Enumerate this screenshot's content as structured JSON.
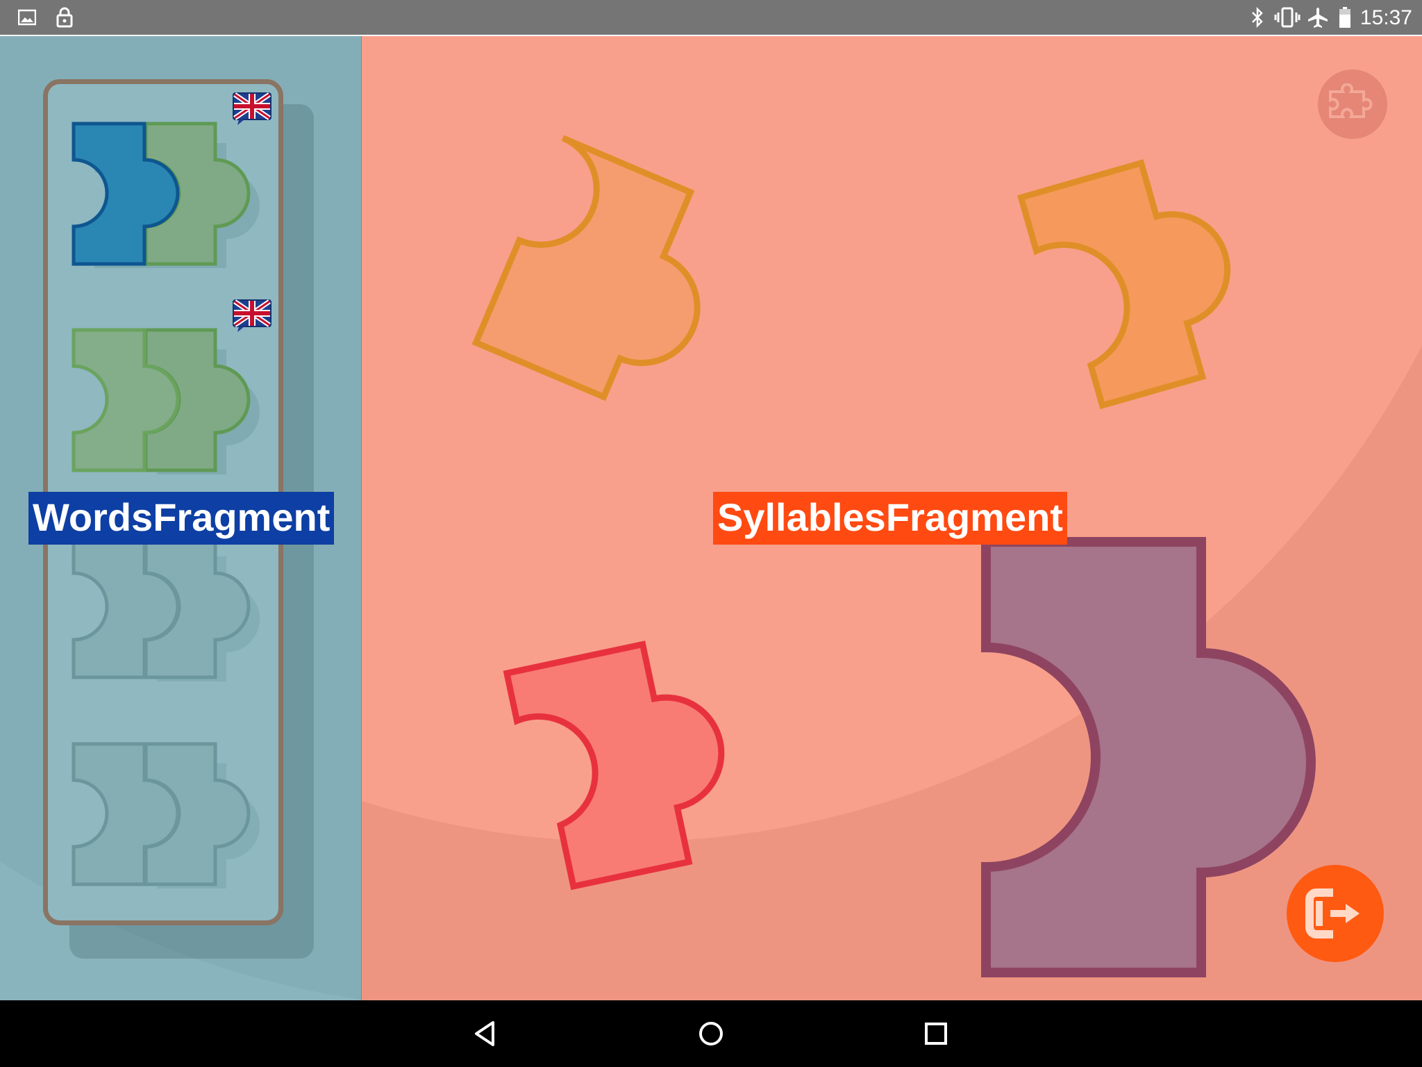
{
  "status_bar": {
    "time": "15:37",
    "left_icons": [
      "image-icon",
      "lock-icon"
    ],
    "right_icons": [
      "bluetooth-icon",
      "vibrate-icon",
      "airplane-icon",
      "battery-icon"
    ]
  },
  "words_fragment": {
    "label": "WordsFragment",
    "slots": [
      {
        "state": "partial",
        "language": "en-GB",
        "colors": [
          "#2a86b2",
          "#80aa85"
        ]
      },
      {
        "state": "complete",
        "language": "en-GB",
        "colors": [
          "#80aa85",
          "#80aa85"
        ]
      },
      {
        "state": "locked",
        "language": null,
        "colors": [
          "#87aeb5",
          "#87aeb5"
        ]
      },
      {
        "state": "locked",
        "language": null,
        "colors": [
          "#87aeb5",
          "#87aeb5"
        ]
      }
    ]
  },
  "syllables_fragment": {
    "label": "SyllablesFragment",
    "pieces": [
      {
        "color": "#f59d6f",
        "stroke": "#e08f28"
      },
      {
        "color": "#f59a5c",
        "stroke": "#e08f28"
      },
      {
        "color": "#f87c74",
        "stroke": "#e8313f"
      },
      {
        "color": "#a6748b",
        "stroke": "#8e4460"
      }
    ]
  },
  "buttons": {
    "puzzle": "puzzle-icon",
    "exit": "exit-icon"
  },
  "nav_bar": {
    "buttons": [
      "back-icon",
      "home-icon",
      "recents-icon"
    ]
  },
  "colors": {
    "left_background": "#8ab4bd",
    "right_background": "#f8a08c",
    "words_label_bg": "#0d3fa4",
    "syllables_label_bg": "#ff4a12",
    "exit_button": "#ff5a12"
  }
}
